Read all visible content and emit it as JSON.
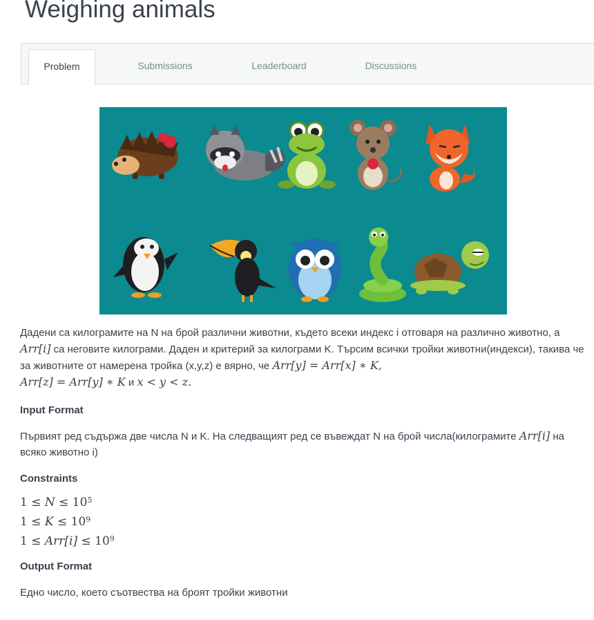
{
  "title": "Weighing animals",
  "tabs": [
    {
      "label": "Problem",
      "active": true
    },
    {
      "label": "Submissions",
      "active": false
    },
    {
      "label": "Leaderboard",
      "active": false
    },
    {
      "label": "Discussions",
      "active": false
    }
  ],
  "hero_image": {
    "background": "#0b8a8f",
    "animals": [
      "hedgehog",
      "raccoon",
      "frog",
      "mouse",
      "fox",
      "penguin",
      "toucan",
      "owl",
      "snake",
      "turtle"
    ]
  },
  "statement": {
    "p1_a": "Дадени са килограмите на N на брой различни животни, където всеки индекс i отговаря на различно животно, а ",
    "arr_i": "Arr[i]",
    "p1_b": " са неговите килограми. Даден и критерий за килограми K. Търсим всички тройки животни(индекси), такива че за животните от намерена тройка (x,y,z) е вярно, че ",
    "eq1": "Arr[y] = Arr[x] ∗ K,",
    "eq2": "Arr[z] = Arr[y] ∗ K",
    "and": " и ",
    "eq3": "x < y < z."
  },
  "input_format": {
    "heading": "Input Format",
    "text_a": "Първият ред съдържа две числа N и K. На следващият ред се въвеждат N на брой числа(килограмите ",
    "arr_i": "Arr[i]",
    "text_b": " на всяко животно i)"
  },
  "constraints": {
    "heading": "Constraints",
    "items": [
      {
        "left": "1 ≤ ",
        "var": "N",
        "right": " ≤ 10",
        "exp": "5"
      },
      {
        "left": "1 ≤ ",
        "var": "K",
        "right": " ≤ 10",
        "exp": "9"
      },
      {
        "left": "1 ≤ ",
        "var": "Arr[i]",
        "right": " ≤ 10",
        "exp": "9"
      }
    ]
  },
  "output_format": {
    "heading": "Output Format",
    "text": "Едно число, което съотвества на броят тройки животни"
  }
}
